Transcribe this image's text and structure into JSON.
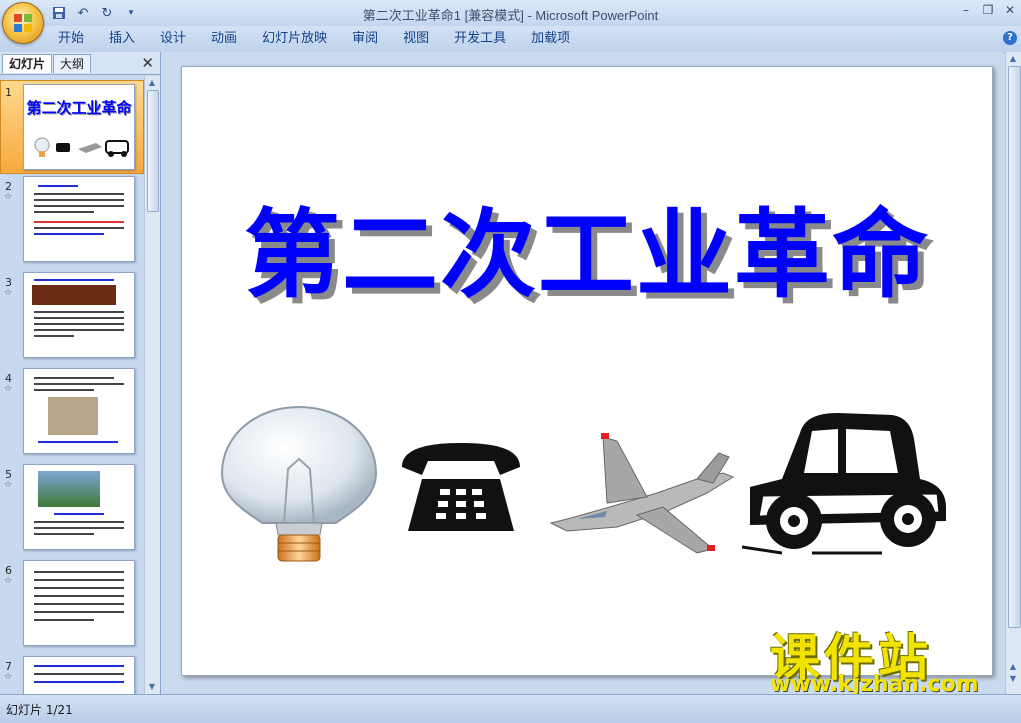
{
  "window": {
    "title": "第二次工业革命1 [兼容模式] - Microsoft PowerPoint"
  },
  "quick_access": {
    "save_icon": "save-icon",
    "undo_icon": "undo-icon",
    "redo_icon": "redo-icon"
  },
  "ribbon": {
    "tabs": [
      "开始",
      "插入",
      "设计",
      "动画",
      "幻灯片放映",
      "审阅",
      "视图",
      "开发工具",
      "加载项"
    ]
  },
  "left_panel": {
    "tabs": [
      "幻灯片",
      "大纲"
    ],
    "slide_numbers": [
      "1",
      "2",
      "3",
      "4",
      "5",
      "6",
      "7"
    ],
    "anim_marker": "☆"
  },
  "slide": {
    "title": "第二次工业革命",
    "thumb_title": "第二次工业革命"
  },
  "watermark": {
    "title": "课件站",
    "url": "www.kjzhan.com"
  },
  "status": {
    "slide_counter": "幻灯片 1/21"
  },
  "colors": {
    "title_blue": "#0000ff",
    "selection_orange": "#f6a93e"
  }
}
